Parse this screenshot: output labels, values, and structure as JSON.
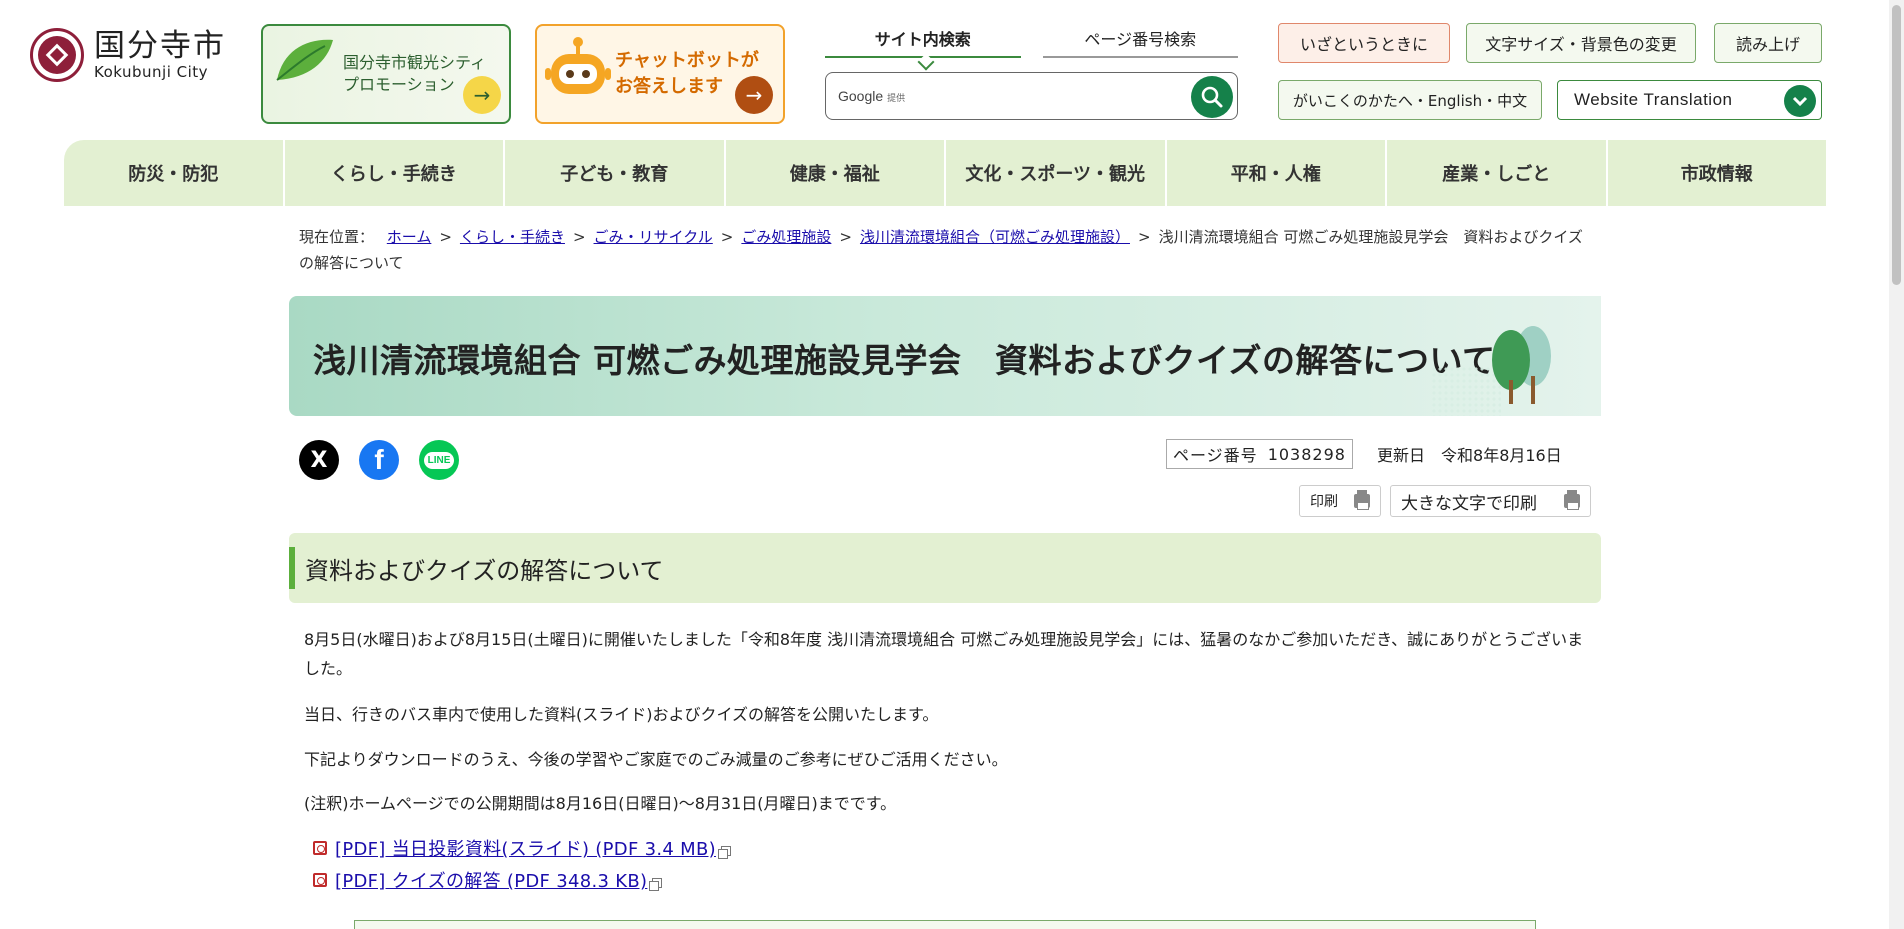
{
  "header": {
    "logo_ja": "国分寺市",
    "logo_en": "Kokubunji City",
    "banner_kanko": "国分寺市観光シティプロモーション",
    "banner_kanko_l1": "国分寺市観光シティ",
    "banner_kanko_l2": "プロモーション",
    "banner_chat_l1": "チャットボットが",
    "banner_chat_l2": "お答えします",
    "search_tab_site": "サイト内検索",
    "search_tab_page": "ページ番号検索",
    "search_google": "Google",
    "search_google_sub": "提供",
    "util_emergency": "いざというときに",
    "util_textsize": "文字サイズ・背景色の変更",
    "util_read": "読み上げ",
    "util_foreign": "がいこくのかたへ・English・中文",
    "translate": "Website Translation"
  },
  "nav": {
    "items": [
      {
        "label": "防災・防犯"
      },
      {
        "label": "くらし・手続き"
      },
      {
        "label": "子ども・教育"
      },
      {
        "label": "健康・福祉"
      },
      {
        "label": "文化・スポーツ・観光"
      },
      {
        "label": "平和・人権"
      },
      {
        "label": "産業・しごと"
      },
      {
        "label": "市政情報"
      }
    ]
  },
  "breadcrumb": {
    "prefix": "現在位置：",
    "links": [
      {
        "label": "ホーム"
      },
      {
        "label": "くらし・手続き"
      },
      {
        "label": "ごみ・リサイクル"
      },
      {
        "label": "ごみ処理施設"
      },
      {
        "label": "浅川清流環境組合（可燃ごみ処理施設）"
      }
    ],
    "current": "浅川清流環境組合 可燃ごみ処理施設見学会　資料およびクイズの解答について"
  },
  "page": {
    "title": "浅川清流環境組合 可燃ごみ処理施設見学会　資料およびクイズの解答について",
    "page_no_label": "ページ番号",
    "page_no": "1038298",
    "updated_label": "更新日",
    "updated_date": "令和8年8月16日",
    "print": "印刷",
    "print_large": "大きな文字で印刷"
  },
  "social": {
    "x": "X",
    "facebook": "f",
    "line": "LINE"
  },
  "content": {
    "section_title": "資料およびクイズの解答について",
    "p1": "8月5日(水曜日)および8月15日(土曜日)に開催いたしました「令和8年度 浅川清流環境組合 可燃ごみ処理施設見学会」には、猛暑のなかご参加いただき、誠にありがとうございました。",
    "p2": "当日、行きのバス車内で使用した資料(スライド)およびクイズの解答を公開いたします。",
    "p3": "下記よりダウンロードのうえ、今後の学習やご家庭でのごみ減量のご参考にぜひご活用ください。",
    "p4": "(注釈)ホームページでの公開期間は8月16日(日曜日)～8月31日(月曜日)までです。",
    "files": [
      {
        "label": "[PDF] 当日投影資料(スライド) (PDF 3.4 MB)"
      },
      {
        "label": "[PDF] クイズの解答 (PDF 348.3 KB)"
      }
    ]
  },
  "colors": {
    "brand": "#8e1f3a",
    "nav_bg": "#e3f0d2",
    "accent_green": "#15814a",
    "link": "#1a0dab"
  }
}
